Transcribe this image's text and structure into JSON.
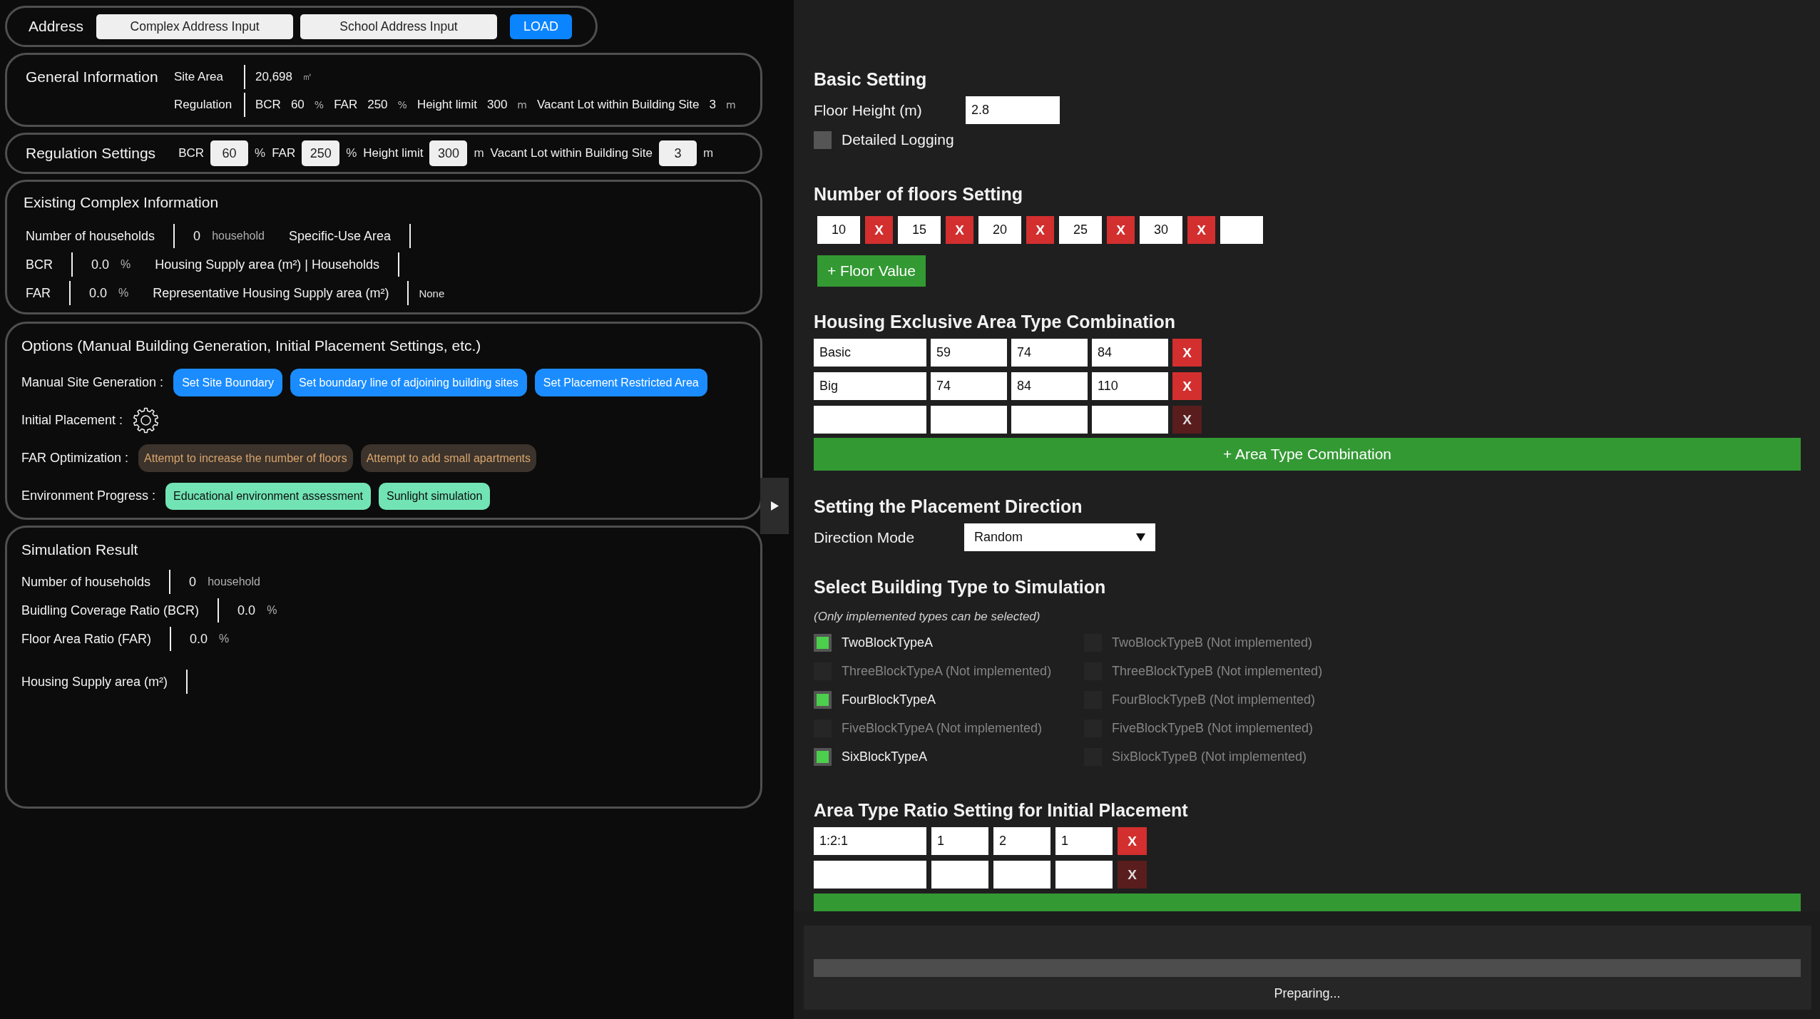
{
  "address_bar": {
    "label": "Address",
    "buttons": [
      {
        "kind": "secondary",
        "label": "Complex Address Input"
      },
      {
        "kind": "secondary",
        "label": "School Address Input"
      },
      {
        "kind": "primary",
        "label": "LOAD"
      }
    ]
  },
  "general_information": {
    "title": "General Information",
    "rows": [
      {
        "items": [
          {
            "kind": "label",
            "text": "Site Area"
          },
          {
            "kind": "divider"
          },
          {
            "kind": "value",
            "text": "20,698"
          },
          {
            "kind": "unit",
            "text": "㎡"
          }
        ]
      },
      {
        "items": [
          {
            "kind": "label",
            "text": "Regulation"
          },
          {
            "kind": "divider"
          },
          {
            "kind": "label",
            "text": "BCR"
          },
          {
            "kind": "value",
            "text": "60"
          },
          {
            "kind": "unit",
            "text": "%"
          },
          {
            "kind": "label",
            "text": "FAR"
          },
          {
            "kind": "value",
            "text": "250"
          },
          {
            "kind": "unit",
            "text": "%"
          },
          {
            "kind": "label",
            "text": "Height limit"
          },
          {
            "kind": "value",
            "text": "300"
          },
          {
            "kind": "unit",
            "text": "m"
          },
          {
            "kind": "label",
            "text": "Vacant Lot within Building Site"
          },
          {
            "kind": "value",
            "text": "3"
          },
          {
            "kind": "unit",
            "text": "m"
          }
        ]
      }
    ]
  },
  "regulation_settings": {
    "title": "Regulation Settings",
    "items": [
      {
        "kind": "label",
        "text": "BCR"
      },
      {
        "kind": "input",
        "value": "60"
      },
      {
        "kind": "unit",
        "text": "%"
      },
      {
        "kind": "label",
        "text": "FAR"
      },
      {
        "kind": "input",
        "value": "250"
      },
      {
        "kind": "unit",
        "text": "%"
      },
      {
        "kind": "label",
        "text": "Height limit"
      },
      {
        "kind": "input",
        "value": "300"
      },
      {
        "kind": "unit",
        "text": "m"
      },
      {
        "kind": "label",
        "text": "Vacant Lot within Building Site"
      },
      {
        "kind": "input",
        "value": "3"
      },
      {
        "kind": "unit",
        "text": "m"
      }
    ]
  },
  "existing_complex": {
    "title": "Existing Complex Information",
    "rows": [
      {
        "items": [
          {
            "kind": "label",
            "text": "Number of households"
          },
          {
            "kind": "divider"
          },
          {
            "kind": "value",
            "text": "0"
          },
          {
            "kind": "unit",
            "text": "household"
          },
          {
            "kind": "label",
            "text": "Specific-Use Area"
          },
          {
            "kind": "divider"
          }
        ]
      },
      {
        "items": [
          {
            "kind": "label",
            "text": "BCR"
          },
          {
            "kind": "divider"
          },
          {
            "kind": "value",
            "text": "0.0"
          },
          {
            "kind": "unit",
            "text": "%"
          },
          {
            "kind": "label",
            "text": "Housing Supply area (m²) | Households"
          },
          {
            "kind": "divider"
          }
        ]
      },
      {
        "items": [
          {
            "kind": "label",
            "text": "FAR"
          },
          {
            "kind": "divider"
          },
          {
            "kind": "value",
            "text": "0.0"
          },
          {
            "kind": "unit",
            "text": "%"
          },
          {
            "kind": "label",
            "text": "Representative Housing Supply area (m²)"
          },
          {
            "kind": "divider"
          },
          {
            "kind": "note",
            "text": "None"
          }
        ]
      }
    ]
  },
  "options": {
    "title": "Options (Manual Building Generation, Initial Placement Settings, etc.)",
    "rows": [
      {
        "label": "Manual Site Generation :",
        "actions": [
          {
            "kind": "primary",
            "label": "Set Site Boundary"
          },
          {
            "kind": "primary",
            "label": "Set boundary line of adjoining building sites"
          },
          {
            "kind": "primary",
            "label": "Set Placement Restricted Area"
          }
        ]
      },
      {
        "label": "Initial Placement :",
        "actions": [
          {
            "kind": "gear"
          }
        ]
      },
      {
        "label": "FAR Optimization :",
        "actions": [
          {
            "kind": "muted",
            "label": "Attempt to increase the number of floors"
          },
          {
            "kind": "muted",
            "label": "Attempt to add small apartments"
          }
        ]
      },
      {
        "label": "Environment Progress :",
        "actions": [
          {
            "kind": "accent",
            "label": "Educational environment assessment"
          },
          {
            "kind": "accent",
            "label": "Sunlight simulation"
          }
        ]
      }
    ]
  },
  "simulation_result": {
    "title": "Simulation Result",
    "rows": [
      {
        "items": [
          {
            "kind": "label",
            "text": "Number of households"
          },
          {
            "kind": "divider"
          },
          {
            "kind": "value",
            "text": "0"
          },
          {
            "kind": "unit",
            "text": "household"
          }
        ]
      },
      {
        "items": [
          {
            "kind": "label",
            "text": "Buidling Coverage Ratio (BCR)"
          },
          {
            "kind": "divider"
          },
          {
            "kind": "value",
            "text": "0.0"
          },
          {
            "kind": "unit",
            "text": "%"
          }
        ]
      },
      {
        "items": [
          {
            "kind": "label",
            "text": "Floor Area Ratio (FAR)"
          },
          {
            "kind": "divider"
          },
          {
            "kind": "value",
            "text": "0.0"
          },
          {
            "kind": "unit",
            "text": "%"
          }
        ]
      },
      {
        "items": [
          {
            "kind": "label",
            "text": "Housing Supply area (m²)"
          },
          {
            "kind": "divider"
          }
        ]
      }
    ]
  },
  "settings": {
    "basic": {
      "title": "Basic Setting",
      "floor_height": {
        "label": "Floor Height (m)",
        "value": "2.8"
      },
      "logging": {
        "label": "Detailed Logging",
        "checked": false
      }
    },
    "floors": {
      "title": "Number of floors Setting",
      "values": [
        {
          "value": "10",
          "remove": "X"
        },
        {
          "value": "15",
          "remove": "X"
        },
        {
          "value": "20",
          "remove": "X"
        },
        {
          "value": "25",
          "remove": "X"
        },
        {
          "value": "30",
          "remove": "X"
        }
      ],
      "add_button": "+ Floor Value"
    },
    "area_combinations": {
      "title": "Housing Exclusive Area Type Combination",
      "rows": [
        {
          "name": "Basic",
          "areas": [
            "59",
            "74",
            "84"
          ],
          "remove": "X",
          "disabled": false
        },
        {
          "name": "Big",
          "areas": [
            "74",
            "84",
            "110"
          ],
          "remove": "X",
          "disabled": false
        },
        {
          "remove": "X",
          "disabled": true
        }
      ],
      "add_button": "+ Area Type Combination"
    },
    "placement_direction": {
      "title": "Setting the Placement Direction",
      "label": "Direction Mode",
      "value": "Random"
    },
    "building_types": {
      "title": "Select Building Type to Simulation",
      "note": "(Only implemented types can be selected)",
      "types": [
        {
          "label": "TwoBlockTypeA",
          "checked": true,
          "disabled": false
        },
        {
          "label": "TwoBlockTypeB (Not implemented)",
          "checked": false,
          "disabled": true
        },
        {
          "label": "ThreeBlockTypeA (Not implemented)",
          "checked": false,
          "disabled": true
        },
        {
          "label": "ThreeBlockTypeB (Not implemented)",
          "checked": false,
          "disabled": true
        },
        {
          "label": "FourBlockTypeA",
          "checked": true,
          "disabled": false
        },
        {
          "label": "FourBlockTypeB (Not implemented)",
          "checked": false,
          "disabled": true
        },
        {
          "label": "FiveBlockTypeA (Not implemented)",
          "checked": false,
          "disabled": true
        },
        {
          "label": "FiveBlockTypeB (Not implemented)",
          "checked": false,
          "disabled": true
        },
        {
          "label": "SixBlockTypeA",
          "checked": true,
          "disabled": false
        },
        {
          "label": "SixBlockTypeB (Not implemented)",
          "checked": false,
          "disabled": true
        }
      ]
    },
    "area_ratios": {
      "title": "Area Type Ratio Setting for Initial Placement",
      "rows": [
        {
          "name": "1:2:1",
          "ratios": [
            "1",
            "2",
            "1"
          ],
          "remove": "X",
          "disabled": false
        },
        {
          "remove": "X",
          "disabled": true
        }
      ]
    }
  },
  "progress": {
    "level": 0,
    "status": "Preparing..."
  }
}
